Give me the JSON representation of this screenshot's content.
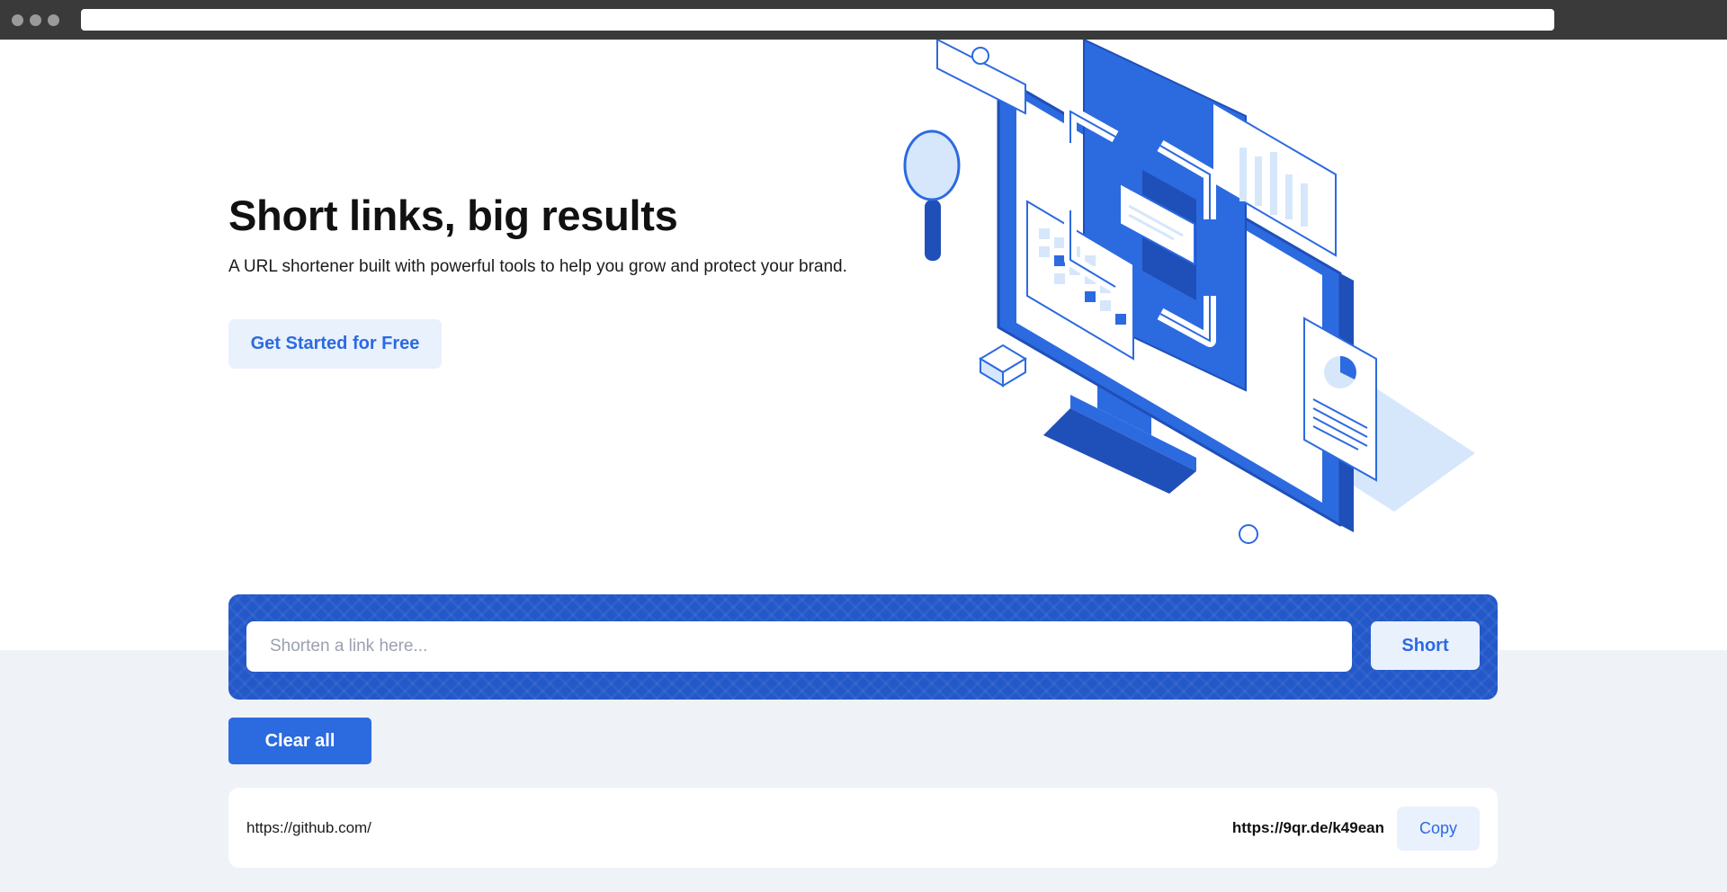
{
  "hero": {
    "title": "Short links, big results",
    "subtitle": "A URL shortener built with powerful tools to help you grow and protect your brand.",
    "cta_label": "Get Started for Free",
    "illustration": "isometric-monitor-analytics-illustration"
  },
  "shortener": {
    "placeholder": "Shorten a link here...",
    "value": "",
    "submit_label": "Short"
  },
  "actions": {
    "clear_label": "Clear all"
  },
  "links": [
    {
      "original": "https://github.com/",
      "short": "https://9qr.de/k49ean",
      "copy_label": "Copy"
    }
  ],
  "colors": {
    "accent": "#2c6ae0",
    "panel": "#2358c9",
    "light_button": "#e9f1fd",
    "lower_background": "#eff2f7",
    "chrome": "#3a3a3a"
  }
}
